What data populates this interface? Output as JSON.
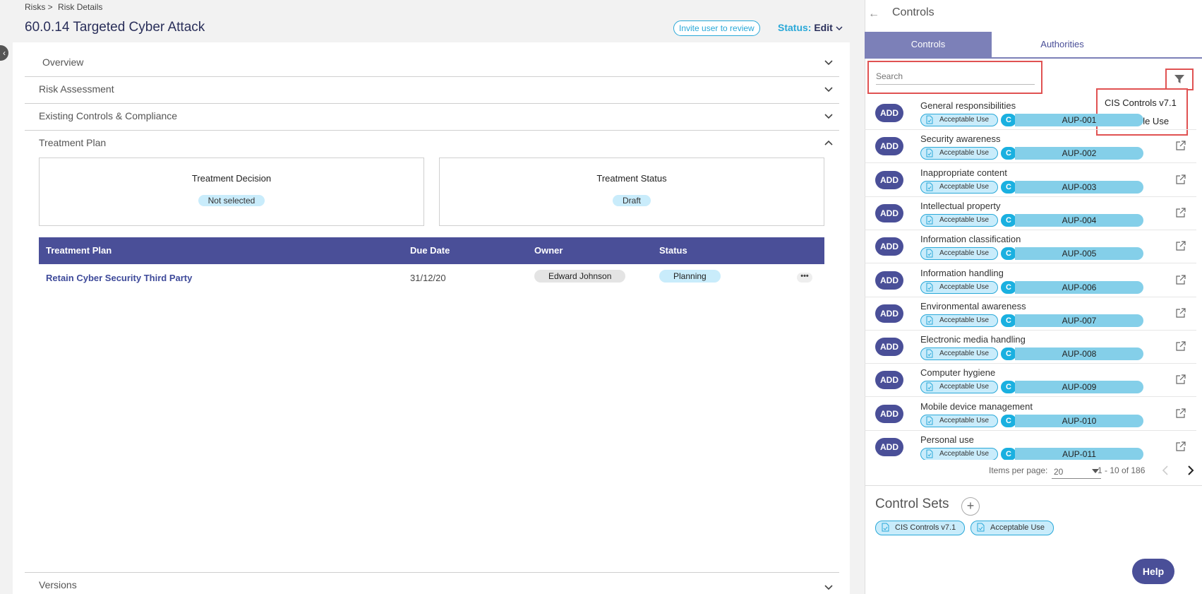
{
  "breadcrumb": {
    "root": "Risks >",
    "current": "Risk Details"
  },
  "page_title": "60.0.14 Targeted Cyber Attack",
  "invite_label": "Invite user to review",
  "status": {
    "label": "Status:",
    "value": "Edit"
  },
  "sections": {
    "overview": "Overview",
    "risk_assessment": "Risk Assessment",
    "existing_controls": "Existing Controls & Compliance",
    "treatment_plan": "Treatment Plan",
    "versions": "Versions"
  },
  "treatment": {
    "decision_title": "Treatment Decision",
    "decision_value": "Not selected",
    "status_title": "Treatment Status",
    "status_value": "Draft"
  },
  "plan_table": {
    "headers": [
      "Treatment Plan",
      "Due Date",
      "Owner",
      "Status"
    ],
    "rows": [
      {
        "name": "Retain Cyber Security Third Party",
        "due": "31/12/20",
        "owner": "Edward Johnson",
        "status": "Planning"
      }
    ]
  },
  "right_panel": {
    "title": "Controls",
    "tabs": [
      "Controls",
      "Authorities"
    ],
    "search_placeholder": "Search",
    "filter_options": [
      "CIS Controls v7.1",
      "Acceptable Use"
    ],
    "add_label": "ADD",
    "tag_label": "Acceptable Use",
    "badge": "C",
    "controls": [
      {
        "name": "General responsibilities",
        "code": "AUP-001"
      },
      {
        "name": "Security awareness",
        "code": "AUP-002"
      },
      {
        "name": "Inappropriate content",
        "code": "AUP-003"
      },
      {
        "name": "Intellectual property",
        "code": "AUP-004"
      },
      {
        "name": "Information classification",
        "code": "AUP-005"
      },
      {
        "name": "Information handling",
        "code": "AUP-006"
      },
      {
        "name": "Environmental awareness",
        "code": "AUP-007"
      },
      {
        "name": "Electronic media handling",
        "code": "AUP-008"
      },
      {
        "name": "Computer hygiene",
        "code": "AUP-009"
      },
      {
        "name": "Mobile device management",
        "code": "AUP-010"
      },
      {
        "name": "Personal use",
        "code": "AUP-011"
      }
    ],
    "pager": {
      "items_label": "Items per page:",
      "per_page": "20",
      "range": "1 - 10 of 186"
    },
    "control_sets_title": "Control Sets",
    "control_sets": [
      "CIS Controls v7.1",
      "Acceptable Use"
    ]
  },
  "help_label": "Help",
  "colors": {
    "primary": "#4a4f98",
    "accent": "#29a8d8",
    "highlight": "#e05252"
  }
}
